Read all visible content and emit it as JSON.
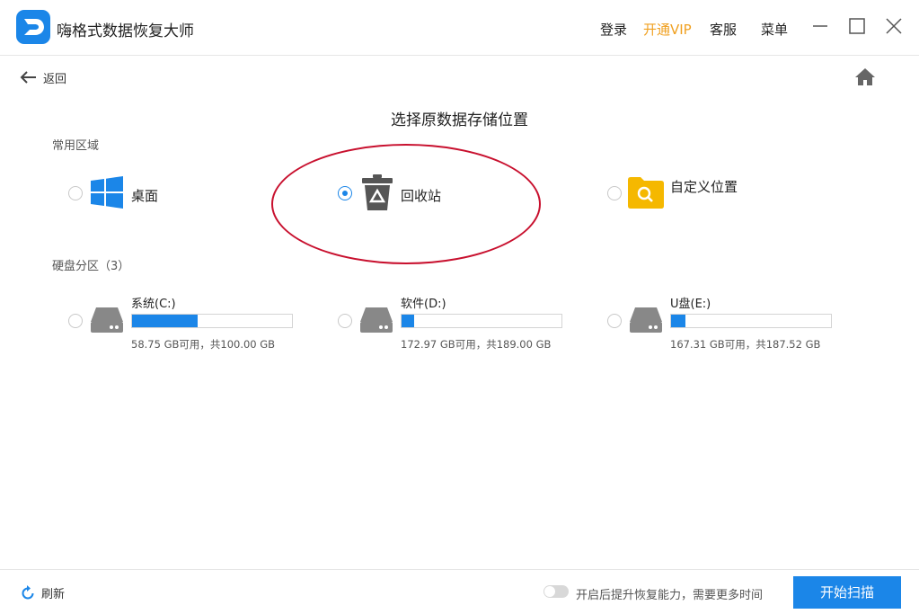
{
  "app": {
    "title": "嗨格式数据恢复大师"
  },
  "header": {
    "login": "登录",
    "vip": "开通VIP",
    "service": "客服",
    "menu": "菜单"
  },
  "nav": {
    "back": "返回"
  },
  "main": {
    "title": "选择原数据存储位置",
    "common_section": "常用区域",
    "common_options": [
      {
        "label": "桌面",
        "icon": "windows-icon",
        "selected": false
      },
      {
        "label": "回收站",
        "icon": "recycle-bin-icon",
        "selected": true
      },
      {
        "label": "自定义位置",
        "icon": "folder-search-icon",
        "selected": false
      }
    ],
    "disk_section": "硬盘分区（3）",
    "disks": [
      {
        "name": "系统(C:)",
        "info": "58.75 GB可用，共100.00 GB",
        "used_fraction": 0.41
      },
      {
        "name": "软件(D:)",
        "info": "172.97 GB可用，共189.00 GB",
        "used_fraction": 0.08
      },
      {
        "name": "U盘(E:)",
        "info": "167.31 GB可用，共187.52 GB",
        "used_fraction": 0.09
      }
    ]
  },
  "footer": {
    "refresh": "刷新",
    "toggle_label": "开启后提升恢复能力，需要更多时间",
    "toggle_on": false,
    "scan_button": "开始扫描"
  },
  "colors": {
    "accent": "#1b86e8",
    "vip": "#f0a020",
    "highlight_ellipse": "#c8102e",
    "folder": "#f5b800"
  }
}
